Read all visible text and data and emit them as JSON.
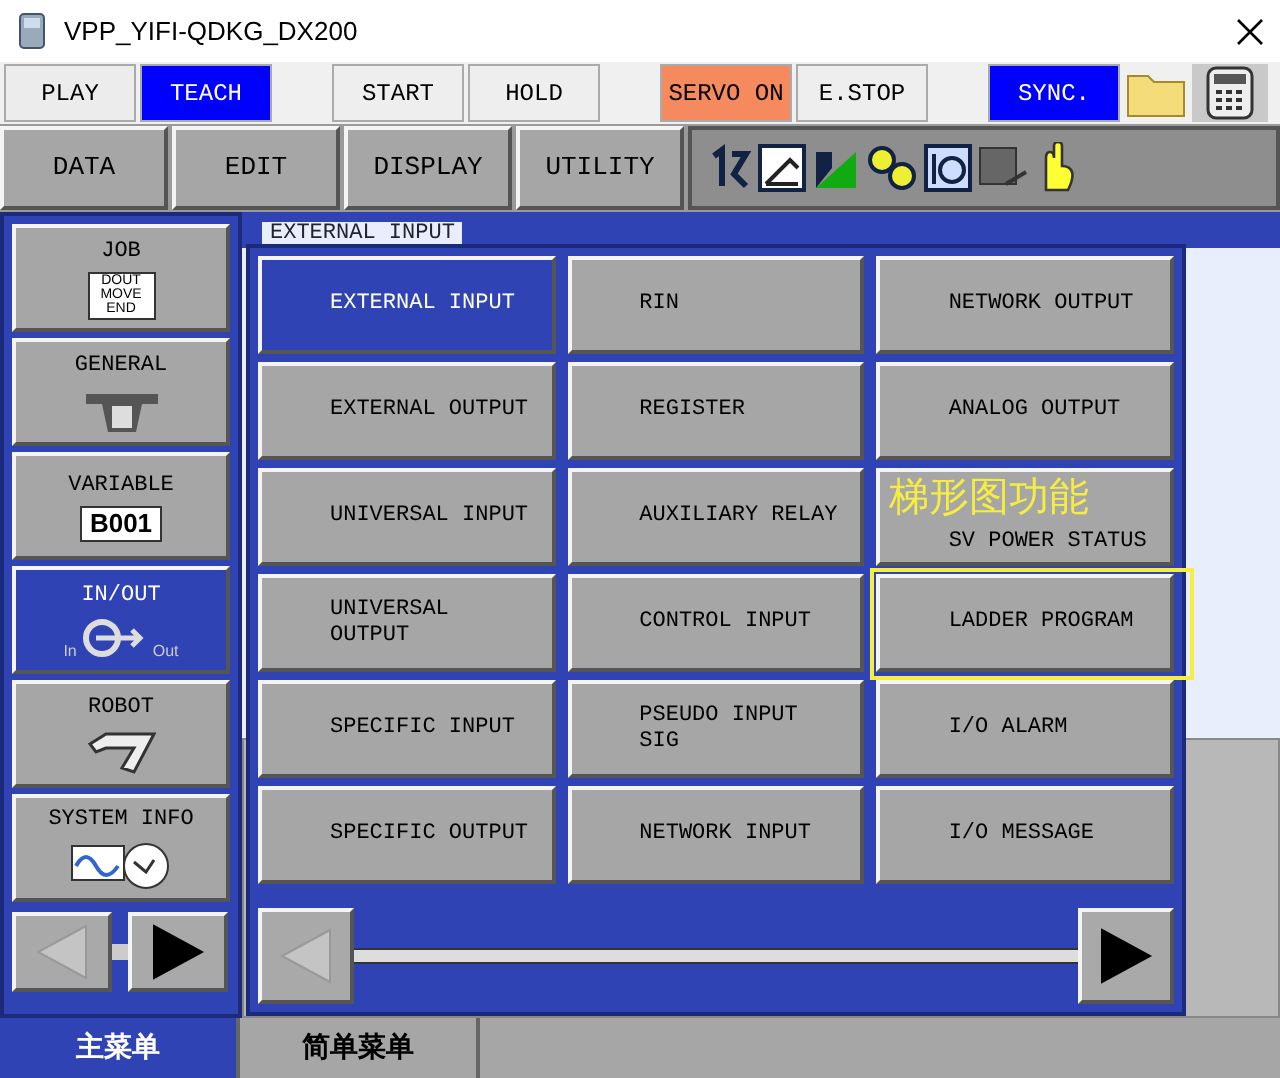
{
  "window": {
    "title": "VPP_YIFI-QDKG_DX200"
  },
  "top_groups": [
    {
      "buttons": [
        {
          "label": "PLAY",
          "kind": "mode",
          "on": false
        },
        {
          "label": "TEACH",
          "kind": "mode",
          "on": true
        }
      ]
    },
    {
      "buttons": [
        {
          "label": "START",
          "kind": "plain",
          "on": false
        },
        {
          "label": "HOLD",
          "kind": "plain",
          "on": false
        }
      ]
    },
    {
      "buttons": [
        {
          "label": "SERVO ON",
          "kind": "servo",
          "on": true
        },
        {
          "label": "E.STOP",
          "kind": "plain",
          "on": false
        }
      ]
    },
    {
      "buttons": [
        {
          "label": "SYNC.",
          "kind": "mode",
          "on": true
        }
      ]
    }
  ],
  "menu_buttons": [
    "DATA",
    "EDIT",
    "DISPLAY",
    "UTILITY"
  ],
  "side_menu": [
    {
      "label": "JOB",
      "kind": "job",
      "icon_lines": [
        "DOUT",
        "MOVE",
        "END"
      ],
      "selected": false
    },
    {
      "label": "GENERAL",
      "kind": "general",
      "selected": false
    },
    {
      "label": "VARIABLE",
      "kind": "variable",
      "icon_lines": [
        "B001"
      ],
      "selected": false
    },
    {
      "label": "IN/OUT",
      "kind": "io",
      "icon_lines": [
        "In",
        "Out"
      ],
      "selected": true
    },
    {
      "label": "ROBOT",
      "kind": "robot",
      "selected": false
    },
    {
      "label": "SYSTEM INFO",
      "kind": "system",
      "selected": false
    }
  ],
  "side_arrows": [
    {
      "disabled": true
    },
    {
      "disabled": false
    }
  ],
  "content": {
    "title": "EXTERNAL INPUT"
  },
  "popup_items": [
    {
      "label": "EXTERNAL INPUT",
      "selected": true,
      "framed": false
    },
    {
      "label": "RIN",
      "selected": false,
      "framed": false
    },
    {
      "label": "NETWORK OUTPUT",
      "selected": false,
      "framed": false
    },
    {
      "label": "EXTERNAL OUTPUT",
      "selected": false,
      "framed": false
    },
    {
      "label": "REGISTER",
      "selected": false,
      "framed": false
    },
    {
      "label": "ANALOG OUTPUT",
      "selected": false,
      "framed": false
    },
    {
      "label": "UNIVERSAL INPUT",
      "selected": false,
      "framed": false
    },
    {
      "label": "AUXILIARY RELAY",
      "selected": false,
      "framed": false
    },
    {
      "label": "SV POWER STATUS",
      "selected": false,
      "framed": false,
      "note": "梯形图功能"
    },
    {
      "label": "UNIVERSAL\nOUTPUT",
      "selected": false,
      "framed": false
    },
    {
      "label": "CONTROL INPUT",
      "selected": false,
      "framed": false
    },
    {
      "label": "LADDER PROGRAM",
      "selected": false,
      "framed": true
    },
    {
      "label": "SPECIFIC INPUT",
      "selected": false,
      "framed": false
    },
    {
      "label": "PSEUDO INPUT\nSIG",
      "selected": false,
      "framed": false
    },
    {
      "label": "I/O ALARM",
      "selected": false,
      "framed": false
    },
    {
      "label": "SPECIFIC OUTPUT",
      "selected": false,
      "framed": false
    },
    {
      "label": "NETWORK INPUT",
      "selected": false,
      "framed": false
    },
    {
      "label": "I/O MESSAGE",
      "selected": false,
      "framed": false
    }
  ],
  "popup_arrows": [
    {
      "disabled": true
    },
    {
      "disabled": false
    }
  ],
  "bottom_tabs": [
    {
      "label": "主菜单",
      "selected": true
    },
    {
      "label": "简单菜单",
      "selected": false
    }
  ]
}
